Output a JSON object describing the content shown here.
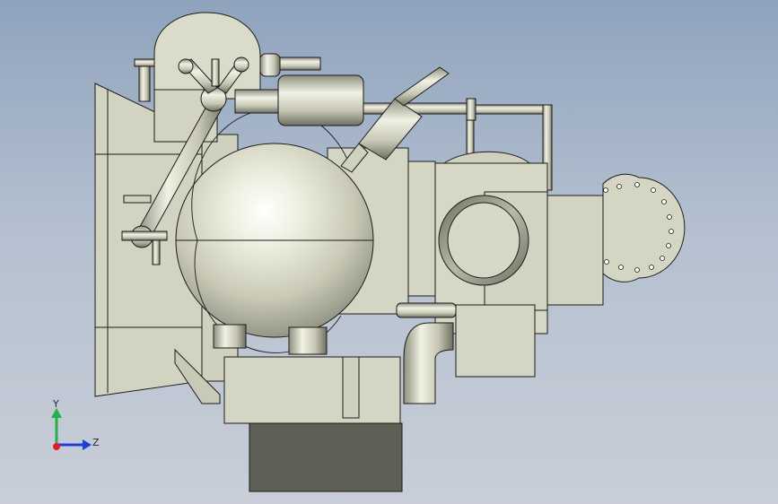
{
  "viewport": {
    "background_top": "#8fa3bd",
    "background_bottom": "#c9ced8",
    "part_color": "#d4d6c4",
    "edge_color": "#1b1b1b"
  },
  "triad": {
    "y_label": "Y",
    "z_label": "Z",
    "y_color": "#22b14c",
    "z_color": "#1f3fd8",
    "x_color": "#e02020"
  }
}
